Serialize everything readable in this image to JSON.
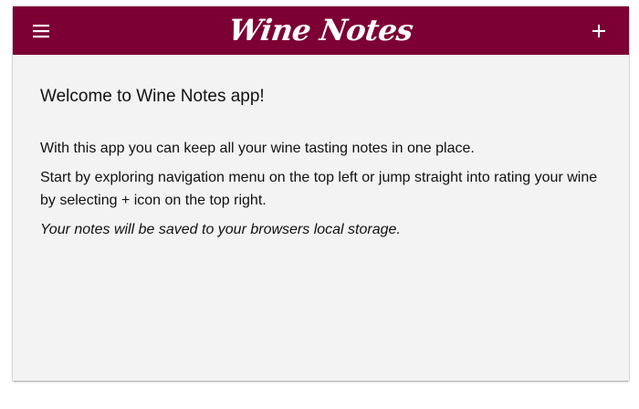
{
  "header": {
    "brand": "Wine Notes",
    "menu_icon": "hamburger-menu-icon",
    "add_icon": "plus-icon",
    "color": "#7d0034"
  },
  "main": {
    "title": "Welcome to Wine Notes app!",
    "paragraphs": [
      "With this app you can keep all your wine tasting notes in one place.",
      "Start by exploring navigation menu on the top left or jump straight into rating your wine by selecting + icon on the top right.",
      "Your notes will be saved to your browsers local storage."
    ],
    "background": "#f3f3f3"
  }
}
